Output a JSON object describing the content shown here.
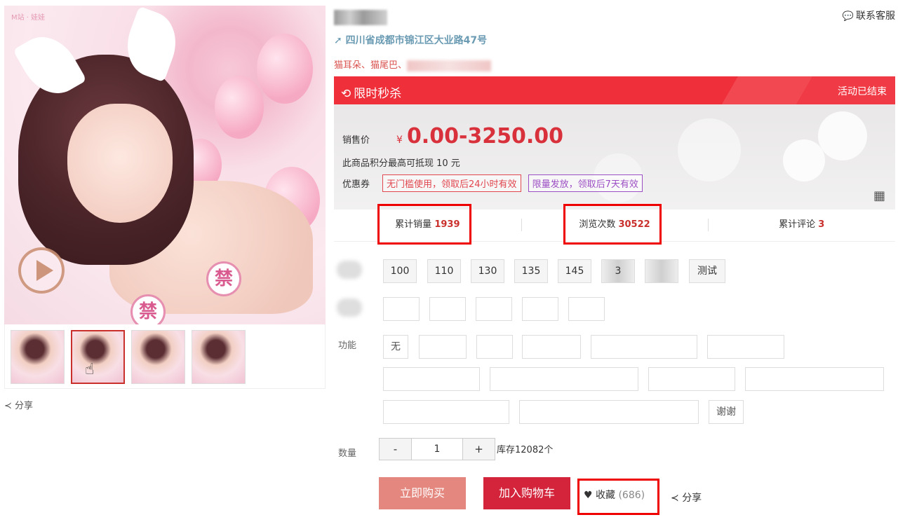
{
  "gallery": {
    "watermark": "M站 · 娃娃",
    "sticker_char": "禁",
    "share_label": "分享"
  },
  "product": {
    "service_label": "联系客服",
    "address": "四川省成都市锦江区大业路47号",
    "tags_prefix": "猫耳朵、猫尾巴、"
  },
  "flash_sale": {
    "title": "限时秒杀",
    "status": "活动已结束"
  },
  "price_box": {
    "price_label": "销售价",
    "currency": "¥",
    "price": "0.00-3250.00",
    "points_text": "此商品积分最高可抵现 10 元",
    "coupon_label": "优惠券",
    "coupons": [
      "无门槛使用，领取后24小时有效",
      "限量发放，领取后7天有效"
    ]
  },
  "stats": {
    "sales_label": "累计销量",
    "sales_value": "1939",
    "views_label": "浏览次数",
    "views_value": "30522",
    "reviews_label": "累计评论",
    "reviews_value": "3"
  },
  "options": {
    "size_options": [
      "100",
      "110",
      "130",
      "135",
      "145",
      "3",
      "",
      "测试"
    ],
    "function_label": "功能",
    "function_first": "无",
    "function_last": "谢谢"
  },
  "quantity": {
    "label": "数量",
    "minus": "-",
    "value": "1",
    "plus": "+",
    "stock": "库存12082个"
  },
  "actions": {
    "buy_now": "立即购买",
    "add_cart": "加入购物车",
    "favorite": "收藏",
    "favorite_count": "(686)",
    "share": "分享"
  },
  "colors": {
    "accent_red": "#d3243b",
    "flash_red": "#ef2f3a",
    "buy_pink": "#e4877e",
    "highlight": "#ee0000"
  }
}
